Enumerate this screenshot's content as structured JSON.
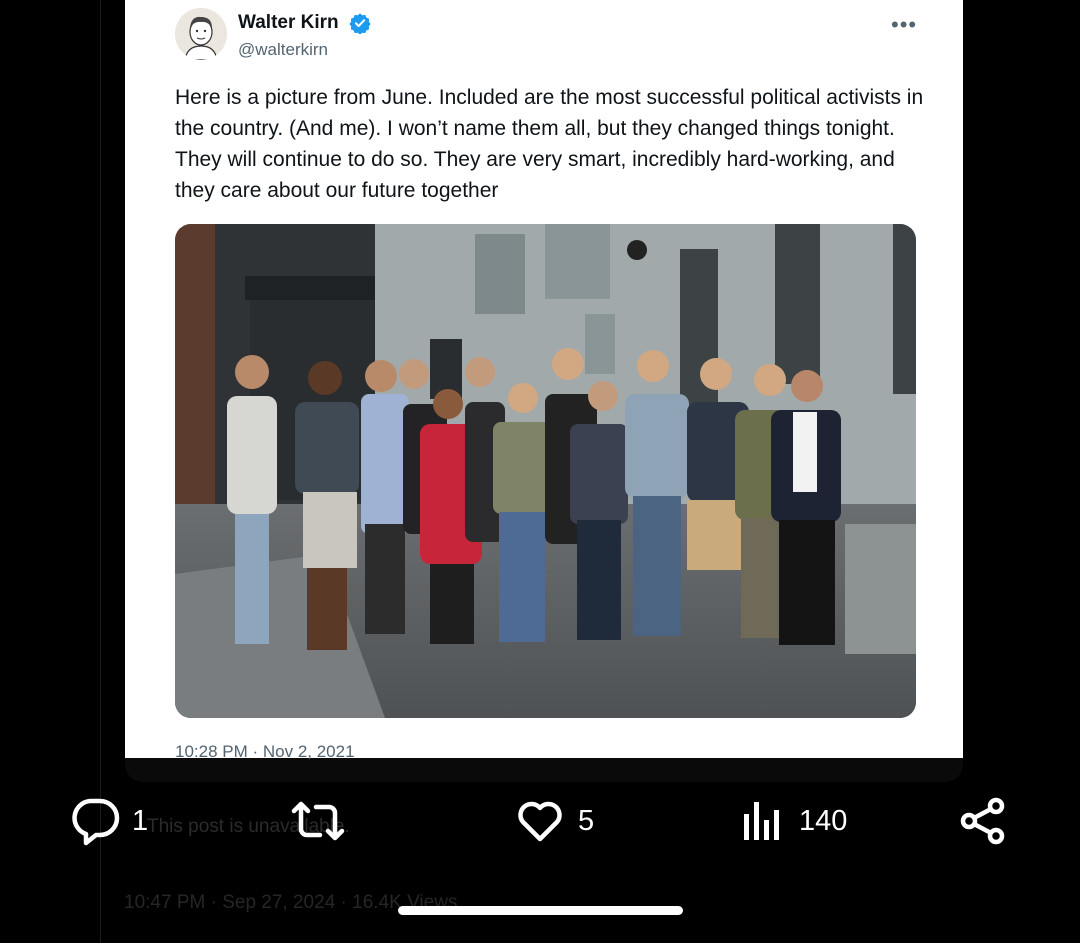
{
  "tweet": {
    "author_name": "Walter Kirn",
    "handle": "@walterkirn",
    "text": "Here is a picture from June. Included are the most successful political activists in the country.  (And me). I won’t name them all, but they changed things tonight. They will continue to do so. They are very smart, incredibly hard-working, and they care about our future together",
    "timestamp": "10:28 PM · Nov 2, 2021",
    "more_icon": "more-horizontal-icon",
    "verified_icon": "verified-badge-icon",
    "accent_color": "#1d9bf0"
  },
  "post": {
    "unavailable_text": "This post is unavailable.",
    "footer_meta": "10:47 PM · Sep 27, 2024 · 16.4K Views"
  },
  "actions": {
    "replies": "1",
    "retweets": "",
    "likes": "5",
    "views": "140",
    "icons": [
      "reply-icon",
      "retweet-icon",
      "like-icon",
      "views-icon",
      "share-icon"
    ]
  }
}
